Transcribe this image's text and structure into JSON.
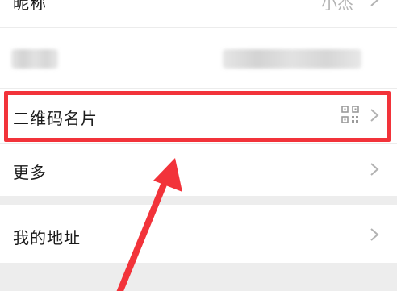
{
  "profile": {
    "nickname_row": {
      "label": "昵称",
      "value": "小杰"
    },
    "account_row": {
      "label": "",
      "value": ""
    },
    "qr_row": {
      "label": "二维码名片",
      "icon": "qr-code-icon"
    },
    "more_row": {
      "label": "更多"
    },
    "address_row": {
      "label": "我的地址"
    }
  },
  "annotation": {
    "highlight_color": "#f2333a"
  },
  "colors": {
    "page_bg": "#ffffff",
    "section_gap": "#ededed",
    "chevron": "#b2b2b2",
    "muted_text": "#b3b3b3"
  }
}
